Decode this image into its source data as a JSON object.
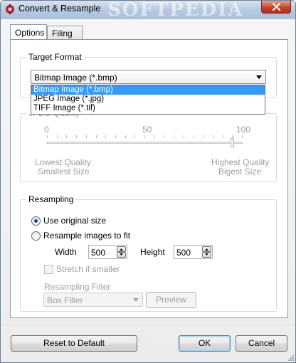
{
  "window": {
    "title": "Convert & Resample",
    "watermark": "SOFTPEDIA"
  },
  "tabs": [
    {
      "label": "Options",
      "active": true
    },
    {
      "label": "Filing",
      "active": false
    }
  ],
  "target_format": {
    "group_label": "Target Format",
    "selected": "Bitmap Image (*.bmp)",
    "options": [
      "Bitmap Image (*.bmp)",
      "JPEG Image (*.jpg)",
      "TIFF Image (*.tif)"
    ]
  },
  "jpeg_quality": {
    "group_label": "JPEG Quality",
    "scale": [
      "0",
      "50",
      "100"
    ],
    "value": 95,
    "low_label_1": "Lowest Quality",
    "low_label_2": "Smallest Size",
    "high_label_1": "Highest Quality",
    "high_label_2": "Bigest Size"
  },
  "resampling": {
    "group_label": "Resampling",
    "use_original_label": "Use original size",
    "resample_label": "Resample images to fit",
    "width_label": "Width",
    "width_value": "500",
    "height_label": "Height",
    "height_value": "500",
    "stretch_label": "Stretch if smaller",
    "filter_label": "Resampling Filter",
    "filter_value": "Box Filter",
    "preview_label": "Preview"
  },
  "footer": {
    "reset_label": "Reset to Default",
    "ok_label": "OK",
    "cancel_label": "Cancel"
  },
  "colors": {
    "selection": "#3399ff",
    "close": "#c8432c"
  }
}
